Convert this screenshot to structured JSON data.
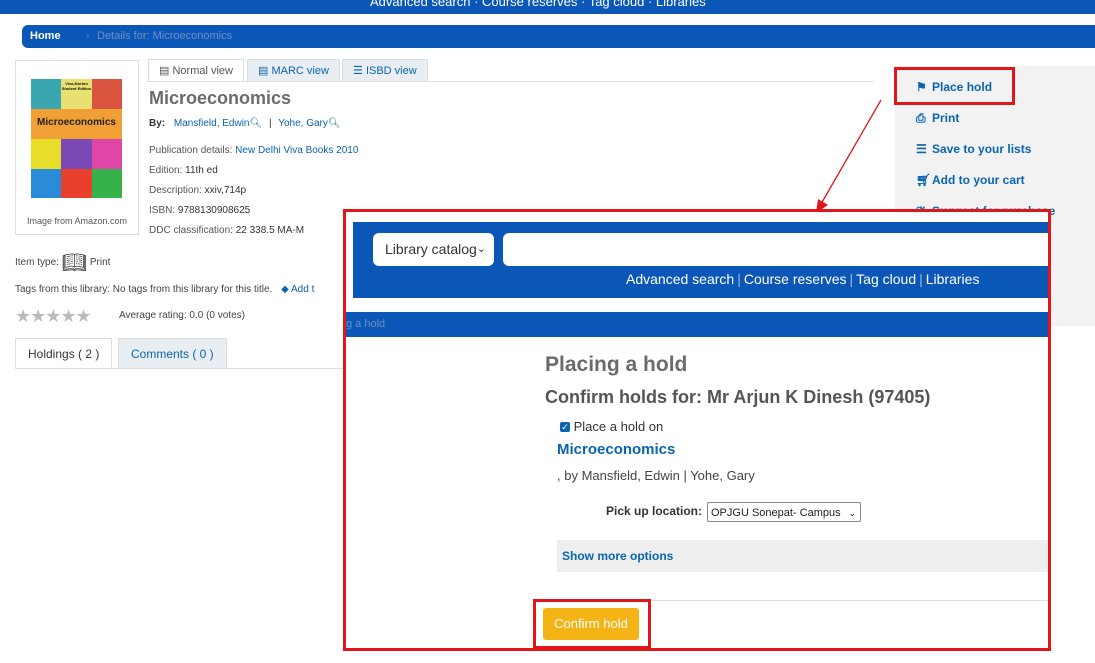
{
  "topnav": {
    "text": "Advanced search · Course reserves · Tag cloud · Libraries"
  },
  "breadcrumb": {
    "home": "Home",
    "separator": "›",
    "current": "Details for: Microeconomics"
  },
  "cover": {
    "edition_line": "Viva-Norton Student Edition",
    "title": "Microeconomics",
    "caption": "Image from Amazon.com"
  },
  "tabs": {
    "normal": "Normal view",
    "marc": "MARC view",
    "isbd": "ISBD view"
  },
  "record": {
    "title": "Microeconomics",
    "by_label": "By:",
    "author1": "Mansfield, Edwin",
    "author2": "Yohe, Gary",
    "pub_label": "Publication details:",
    "pub_value": "New Delhi Viva Books 2010",
    "edition_label": "Edition:",
    "edition_value": "11th ed",
    "desc_label": "Description:",
    "desc_value": "xxiv,714p",
    "isbn_label": "ISBN:",
    "isbn_value": "9788130908625",
    "ddc_label": "DDC classification:",
    "ddc_value": "22 338.5 MA-M"
  },
  "item_type": {
    "label": "Item type:",
    "value": "Print"
  },
  "tags": {
    "text": "Tags from this library: No tags from this library for this title.",
    "add": "Add t"
  },
  "rating": {
    "stars": "★★★★★",
    "text": "Average rating: 0.0 (0 votes)",
    "value": 0
  },
  "holdings_tabs": {
    "holdings": "Holdings ( 2 )",
    "comments": "Comments ( 0 )"
  },
  "sidebar": {
    "place_hold": "Place hold",
    "print": "Print",
    "save_lists": "Save to your lists",
    "add_cart": "Add to your cart",
    "suggest": "Suggest for purchase"
  },
  "overlay": {
    "catalog_select": "Library catalog",
    "nav": [
      "Advanced search",
      "Course reserves",
      "Tag cloud",
      "Libraries"
    ],
    "crumb": "g a hold",
    "heading": "Placing a hold",
    "confirm_for": "Confirm holds for: Mr Arjun K Dinesh (97405)",
    "place_on": "Place a hold on",
    "book_title": "Microeconomics",
    "byline": ", by Mansfield, Edwin | Yohe, Gary",
    "pickup_label": "Pick up location:",
    "pickup_value": "OPJGU Sonepat- Campus",
    "more_options": "Show more options",
    "confirm_button": "Confirm hold"
  },
  "colors": {
    "brand_blue": "#0a57b7",
    "link": "#0a64ae",
    "highlight_red": "#e0161a",
    "confirm_yellow": "#f5b416"
  }
}
